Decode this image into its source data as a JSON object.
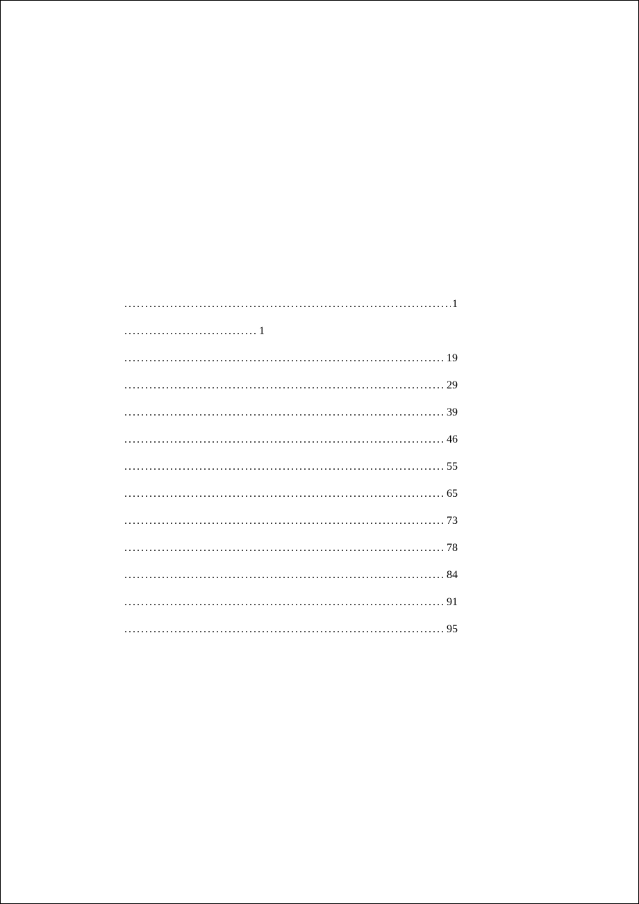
{
  "toc": {
    "entries": [
      {
        "title": "",
        "page": "1",
        "short": false
      },
      {
        "title": "",
        "page": "1",
        "short": true
      },
      {
        "title": "",
        "page": "19",
        "short": false
      },
      {
        "title": "",
        "page": "29",
        "short": false
      },
      {
        "title": "",
        "page": "39",
        "short": false
      },
      {
        "title": "",
        "page": "46",
        "short": false
      },
      {
        "title": "",
        "page": "55",
        "short": false
      },
      {
        "title": "",
        "page": "65",
        "short": false
      },
      {
        "title": "",
        "page": "73",
        "short": false
      },
      {
        "title": "",
        "page": "78",
        "short": false
      },
      {
        "title": "",
        "page": "84",
        "short": false
      },
      {
        "title": "",
        "page": "91",
        "short": false
      },
      {
        "title": "",
        "page": "95",
        "short": false
      }
    ]
  }
}
